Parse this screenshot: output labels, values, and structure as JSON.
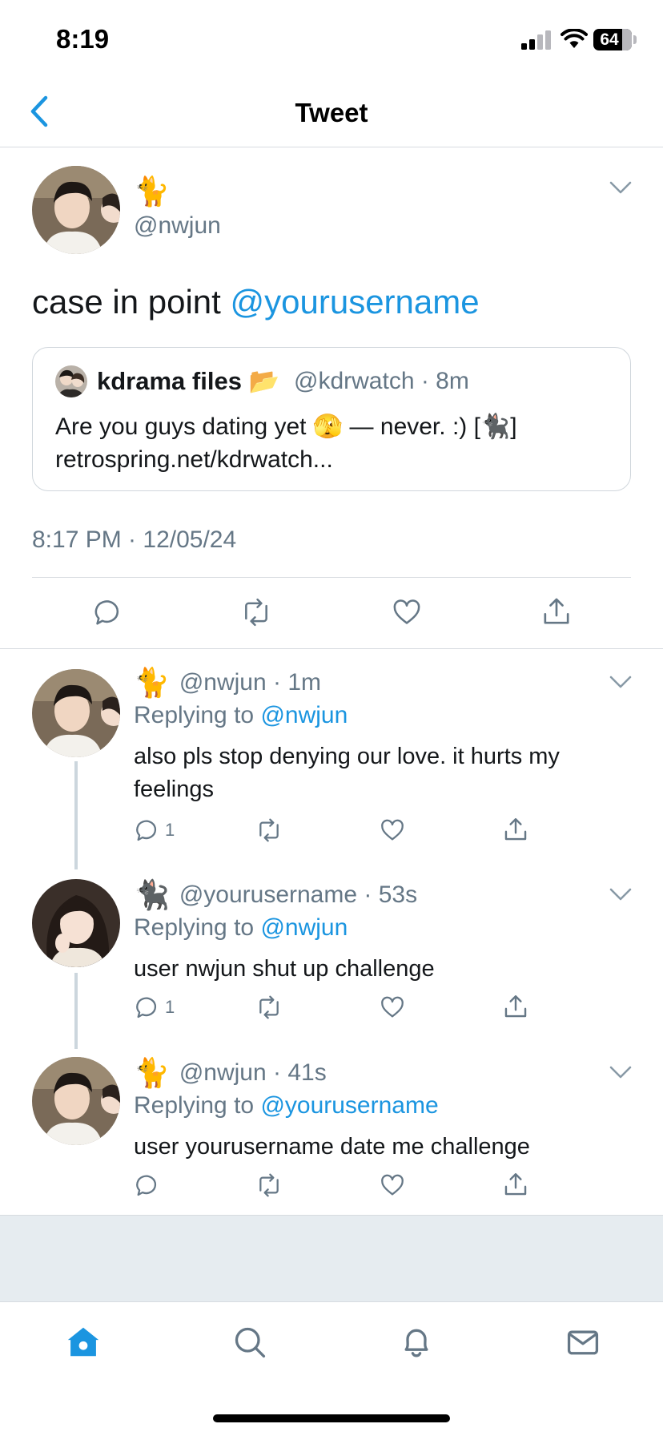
{
  "status_bar": {
    "time": "8:19",
    "battery": "64"
  },
  "header": {
    "title": "Tweet",
    "back_icon": "chevron-left-icon"
  },
  "colors": {
    "accent": "#1b95e0",
    "secondary_text": "#657786",
    "divider": "#d7dbe0"
  },
  "main_tweet": {
    "emoji": "🐈",
    "handle": "@nwjun",
    "text_prefix": "case in point ",
    "text_mention": "@yourusername",
    "quote": {
      "name": "kdrama files",
      "name_emoji": "📂",
      "handle": "@kdrwatch",
      "time": "8m",
      "text": "Are you guys dating yet 🫣 — never. :) [🐈‍⬛] retrospring.net/kdrwatch..."
    },
    "timestamp": "8:17 PM · 12/05/24"
  },
  "replies": [
    {
      "emoji": "🐈",
      "handle": "@nwjun",
      "time": "1m",
      "replying_label": "Replying to ",
      "replying_to": "@nwjun",
      "text": "also pls stop denying our love. it hurts my feelings",
      "reply_count": "1"
    },
    {
      "emoji": "🐈‍⬛",
      "handle": "@yourusername",
      "time": "53s",
      "replying_label": "Replying to ",
      "replying_to": "@nwjun",
      "text": "user nwjun shut up challenge",
      "reply_count": "1"
    },
    {
      "emoji": "🐈",
      "handle": "@nwjun",
      "time": "41s",
      "replying_label": "Replying to ",
      "replying_to": "@yourusername",
      "text": "user yourusername date me challenge",
      "reply_count": ""
    }
  ],
  "tab_bar": {
    "tabs": [
      "home-icon",
      "search-icon",
      "bell-icon",
      "mail-icon"
    ],
    "active": "home-icon"
  }
}
